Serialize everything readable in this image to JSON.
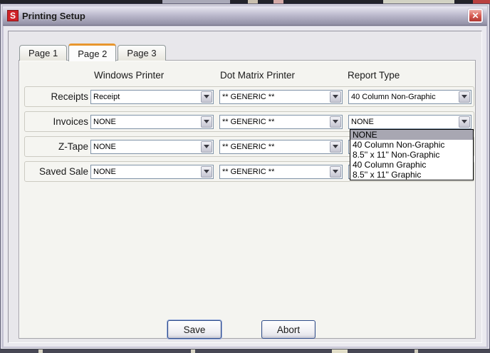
{
  "window": {
    "title": "Printing Setup",
    "icon_letter": "S",
    "close_glyph": "✕"
  },
  "tabs": [
    {
      "label": "Page 1",
      "active": false
    },
    {
      "label": "Page 2",
      "active": true
    },
    {
      "label": "Page 3",
      "active": false
    }
  ],
  "columns": [
    "Windows Printer",
    "Dot Matrix Printer",
    "Report Type"
  ],
  "rows": [
    {
      "label": "Receipts",
      "windows_printer": "Receipt",
      "dot_matrix_printer": "** GENERIC **",
      "report_type": "40 Column Non-Graphic"
    },
    {
      "label": "Invoices",
      "windows_printer": "NONE",
      "dot_matrix_printer": "** GENERIC **",
      "report_type": "NONE"
    },
    {
      "label": "Z-Tape",
      "windows_printer": "NONE",
      "dot_matrix_printer": "** GENERIC **",
      "report_type": ""
    },
    {
      "label": "Saved Sale",
      "windows_printer": "NONE",
      "dot_matrix_printer": "** GENERIC **",
      "report_type": ""
    }
  ],
  "dropdown": {
    "open_for": "Invoices Report Type",
    "selected": "NONE",
    "options": [
      "NONE",
      "40 Column Non-Graphic",
      "8.5'' x 11'' Non-Graphic",
      "40 Column Graphic",
      "8.5'' x 11'' Graphic"
    ]
  },
  "buttons": {
    "save": "Save",
    "abort": "Abort"
  },
  "colors": {
    "active_tab_accent": "#E8962E",
    "titlebar_silver": "#BDBBCE",
    "close_button_red": "#D4574E",
    "app_icon_red": "#CE2127",
    "dropdown_highlight": "#A8A7B2",
    "button_border_blue": "#2F4D8A"
  }
}
